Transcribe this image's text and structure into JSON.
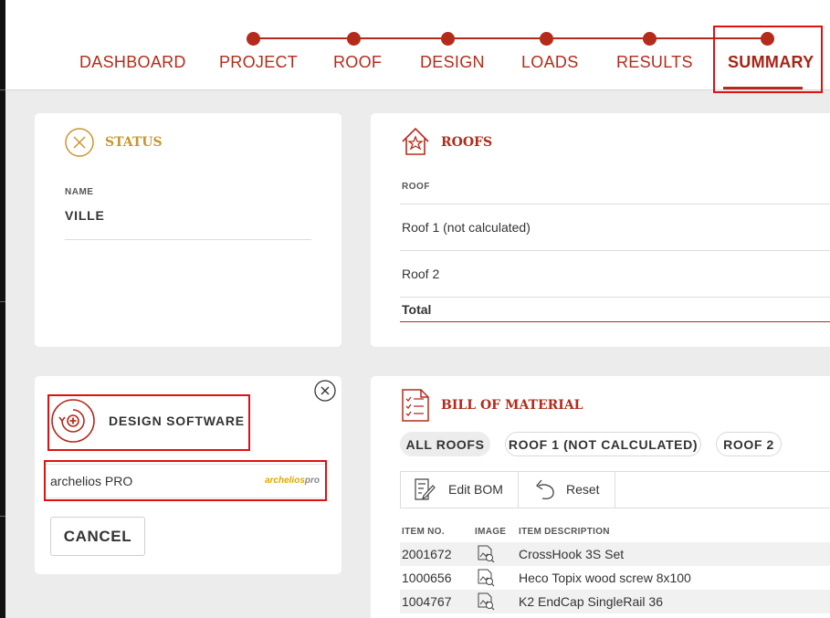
{
  "nav": {
    "steps": [
      {
        "label": "DASHBOARD"
      },
      {
        "label": "PROJECT"
      },
      {
        "label": "ROOF"
      },
      {
        "label": "DESIGN"
      },
      {
        "label": "LOADS"
      },
      {
        "label": "RESULTS"
      },
      {
        "label": "SUMMARY",
        "active": true
      }
    ]
  },
  "status": {
    "title": "STATUS",
    "name_label": "NAME",
    "name_value": "VILLE"
  },
  "roofs": {
    "title": "ROOFS",
    "column_header": "ROOF",
    "rows": [
      "Roof 1 (not calculated)",
      "Roof 2"
    ],
    "total_label": "Total"
  },
  "design_software": {
    "title": "DESIGN SOFTWARE",
    "option_label": "archelios PRO",
    "logo_text_a": "archelios",
    "logo_text_b": "pro",
    "cancel_label": "CANCEL"
  },
  "bom": {
    "title": "BILL OF MATERIAL",
    "filters": [
      "ALL ROOFS",
      "ROOF 1 (NOT CALCULATED)",
      "ROOF 2"
    ],
    "edit_label": "Edit BOM",
    "reset_label": "Reset",
    "columns": [
      "ITEM NO.",
      "IMAGE",
      "ITEM DESCRIPTION"
    ],
    "rows": [
      {
        "item_no": "2001672",
        "description": "CrossHook 3S Set"
      },
      {
        "item_no": "1000656",
        "description": "Heco Topix wood screw 8x100"
      },
      {
        "item_no": "1004767",
        "description": "K2 EndCap SingleRail 36"
      }
    ]
  },
  "colors": {
    "accent": "#b52b1b",
    "status_gold": "#c9962e",
    "highlight": "#e01010"
  }
}
